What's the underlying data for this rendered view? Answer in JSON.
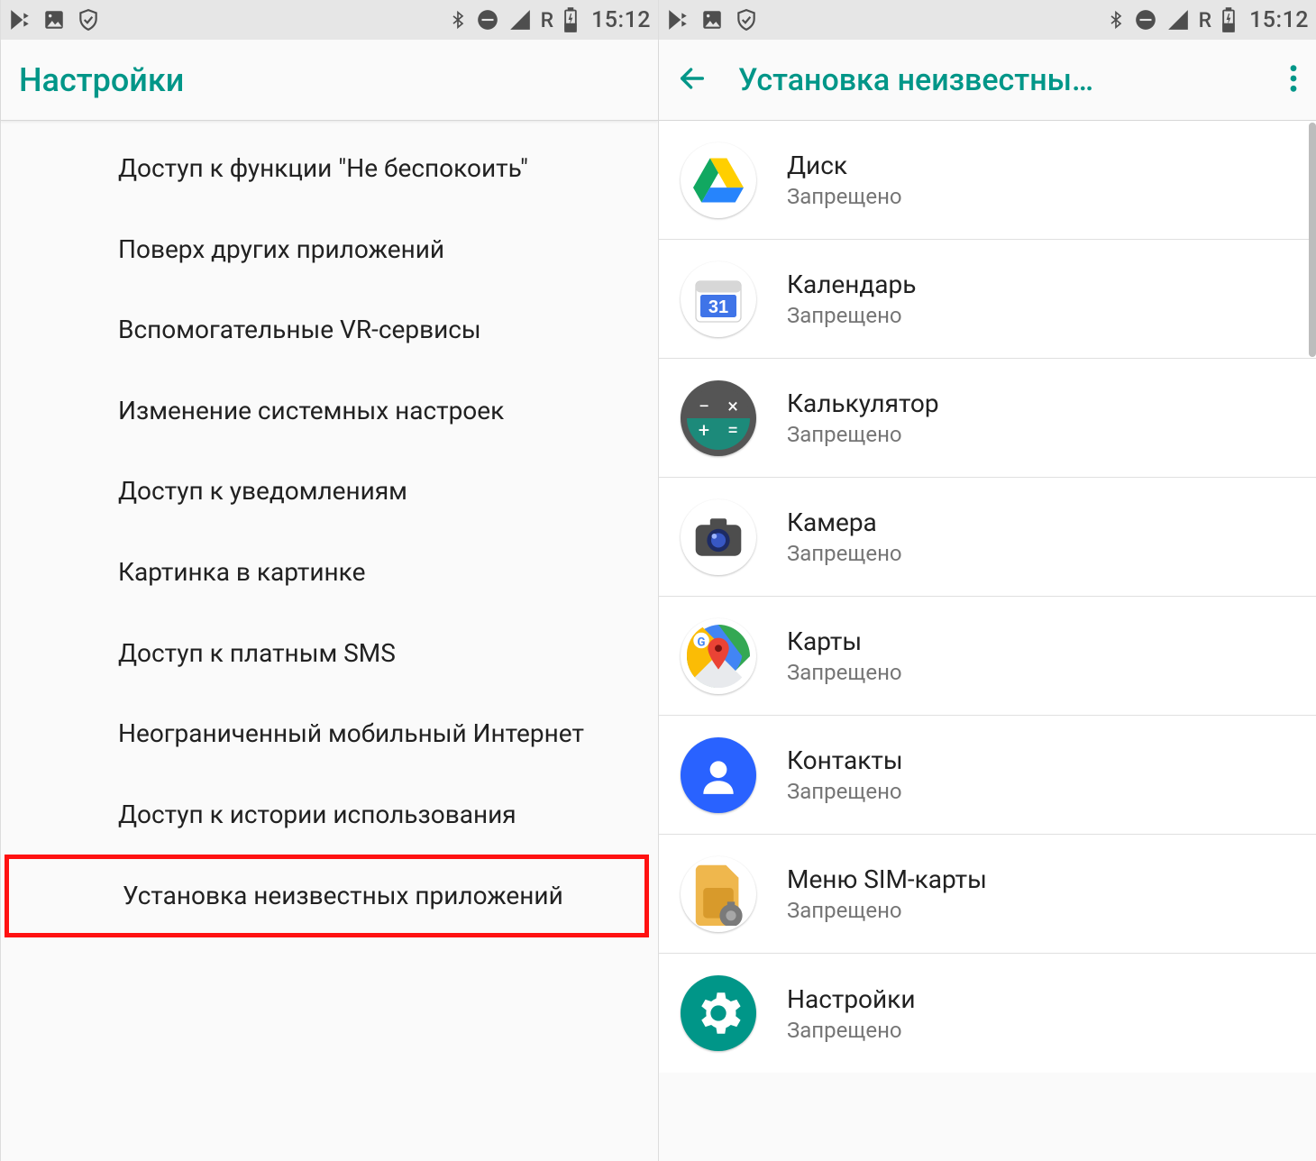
{
  "status": {
    "time": "15:12",
    "network_label": "R"
  },
  "left_screen": {
    "title": "Настройки",
    "items": [
      "Доступ к функции \"Не беспокоить\"",
      "Поверх других приложений",
      "Вспомогательные VR-сервисы",
      "Изменение системных настроек",
      "Доступ к уведомлениям",
      "Картинка в картинке",
      "Доступ к платным SMS",
      "Неограниченный мобильный Интернет",
      "Доступ к истории использования",
      "Установка неизвестных приложений"
    ],
    "highlight_index": 9
  },
  "right_screen": {
    "title": "Установка неизвестны…",
    "status_label": "Запрещено",
    "apps": [
      {
        "name": "Диск",
        "icon": "drive"
      },
      {
        "name": "Календарь",
        "icon": "calendar",
        "badge": "31"
      },
      {
        "name": "Калькулятор",
        "icon": "calc"
      },
      {
        "name": "Камера",
        "icon": "camera"
      },
      {
        "name": "Карты",
        "icon": "maps"
      },
      {
        "name": "Контакты",
        "icon": "contacts"
      },
      {
        "name": "Меню SIM-карты",
        "icon": "sim"
      },
      {
        "name": "Настройки",
        "icon": "settings"
      }
    ]
  }
}
